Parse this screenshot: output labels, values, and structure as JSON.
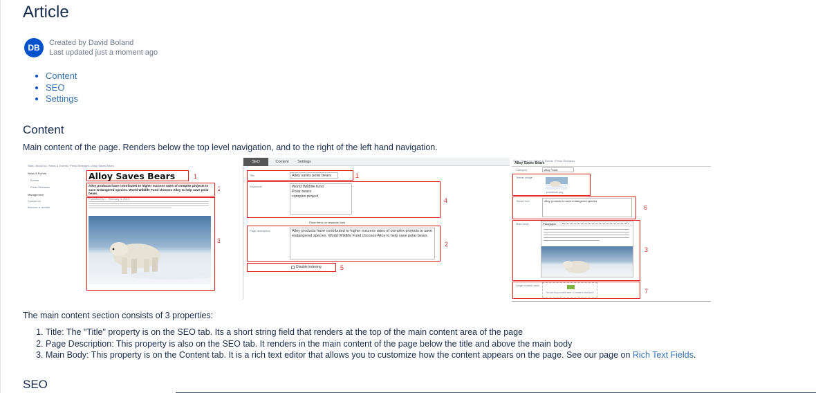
{
  "page": {
    "title": "Article",
    "byline": {
      "avatar_initials": "DB",
      "created_by": "Created by David Boland",
      "last_updated": "Last updated just a moment ago"
    }
  },
  "toc": [
    "Content",
    "SEO",
    "Settings"
  ],
  "content_section": {
    "heading": "Content",
    "description": "Main content of the page. Renders below the top level navigation, and to the right of the left hand navigation.",
    "intro": "The main content section consists of 3 properties:",
    "properties": [
      "Title: The \"Title\" property is on the SEO tab. Its a short string field that renders at the top of the main content area of the page",
      "Page Description: This property is also on the SEO tab. It renders in the main content of the page below the title and above the main body",
      "Main Body: This property is on the Content tab. It is a rich text editor that allows you to customize how the content appears on the page. See our page on "
    ],
    "rich_text_link": "Rich Text Fields",
    "period": "."
  },
  "seo_section": {
    "heading": "SEO"
  },
  "screenshot_page": {
    "breadcrumb": "Start / About us / News & Events / Press Releases / Alloy Saves Bears",
    "nav": [
      "News & Events",
      "Events",
      "Press Releases",
      "Management",
      "Contact us",
      "Become a reseller"
    ],
    "title": "Alloy Saves Bears",
    "description": "Alloy products have contributed to higher success rates of complex projects to save endangered species. World Wildlife Fund chooses Alloy to help save polar bears.",
    "meta": "Published by ... February 3, 2013",
    "callouts": [
      "1",
      "2",
      "3"
    ]
  },
  "screenshot_seo": {
    "tabs": [
      "SEO",
      "Content",
      "Settings"
    ],
    "title_label": "Title",
    "title_value": "Alloy saves polar bears",
    "keywords_label": "Keywords",
    "keywords_value": [
      "World Wildlife fund",
      "Polar bears",
      "complex project"
    ],
    "keywords_hint": "Place items on separate lines",
    "description_label": "Page description",
    "description_value": "Alloy products have contributed to higher success rates of complex projects to save endangered species. World Wildlife Fund chooses Alloy to help save polar bears.",
    "disable_indexing": "Disable indexing",
    "callouts": [
      "1",
      "4",
      "2",
      "5"
    ]
  },
  "screenshot_content": {
    "breadcrumb": "Start / About us / News & Events / Press Releases",
    "title": "Alloy Saves Bears",
    "category_label": "Category",
    "category_value": "Alloy Track",
    "image_label": "Teaser image",
    "image_file": "polarbear.png",
    "teaser_label": "Teaser text",
    "teaser_value": "Alloy products to save endangered species",
    "body_label": "Main body",
    "body_format": "Paragraph",
    "block_label": "Large content area",
    "block_hint": "You can drop content here, or create a new block",
    "callouts": [
      "6",
      "3",
      "7"
    ]
  }
}
